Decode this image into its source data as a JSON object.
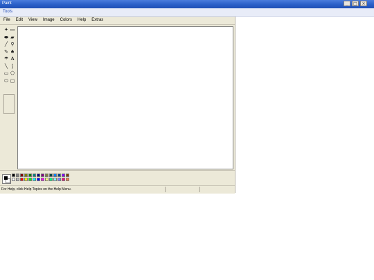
{
  "window": {
    "title": "Paint",
    "controls": [
      "_",
      "□",
      "×"
    ]
  },
  "tools_bar": {
    "label": "Tools"
  },
  "menu": [
    {
      "label": "File"
    },
    {
      "label": "Edit"
    },
    {
      "label": "View"
    },
    {
      "label": "Image"
    },
    {
      "label": "Colors"
    },
    {
      "label": "Help"
    },
    {
      "label": "Extras"
    }
  ],
  "tools": [
    {
      "name": "free-form-select-icon",
      "glyph": "✦"
    },
    {
      "name": "select-icon",
      "glyph": "▭"
    },
    {
      "name": "eraser-icon",
      "glyph": "⬬"
    },
    {
      "name": "fill-icon",
      "glyph": "▰"
    },
    {
      "name": "pick-color-icon",
      "glyph": "╱"
    },
    {
      "name": "magnifier-icon",
      "glyph": "⚲"
    },
    {
      "name": "pencil-icon",
      "glyph": "✎"
    },
    {
      "name": "brush-icon",
      "glyph": "♠"
    },
    {
      "name": "airbrush-icon",
      "glyph": "☂"
    },
    {
      "name": "text-icon",
      "glyph": "A"
    },
    {
      "name": "line-icon",
      "glyph": "╲"
    },
    {
      "name": "curve-icon",
      "glyph": "⟆"
    },
    {
      "name": "rectangle-icon",
      "glyph": "▭"
    },
    {
      "name": "polygon-icon",
      "glyph": "⬠"
    },
    {
      "name": "ellipse-icon",
      "glyph": "⬭"
    },
    {
      "name": "rounded-rectangle-icon",
      "glyph": "▢"
    }
  ],
  "palette": {
    "foreground": "#000000",
    "background": "#ffffff",
    "colors": [
      "#000000",
      "#808080",
      "#800000",
      "#808000",
      "#008000",
      "#008080",
      "#000080",
      "#800080",
      "#808040",
      "#004040",
      "#0080ff",
      "#004080",
      "#8000ff",
      "#804000",
      "#ffffff",
      "#c0c0c0",
      "#ff0000",
      "#ffff00",
      "#00ff00",
      "#00ffff",
      "#0000ff",
      "#ff00ff",
      "#ffff80",
      "#00ff80",
      "#80ffff",
      "#8080ff",
      "#ff0080",
      "#ff8040"
    ]
  },
  "status": {
    "text": "For Help, click Help Topics on the Help Menu."
  }
}
